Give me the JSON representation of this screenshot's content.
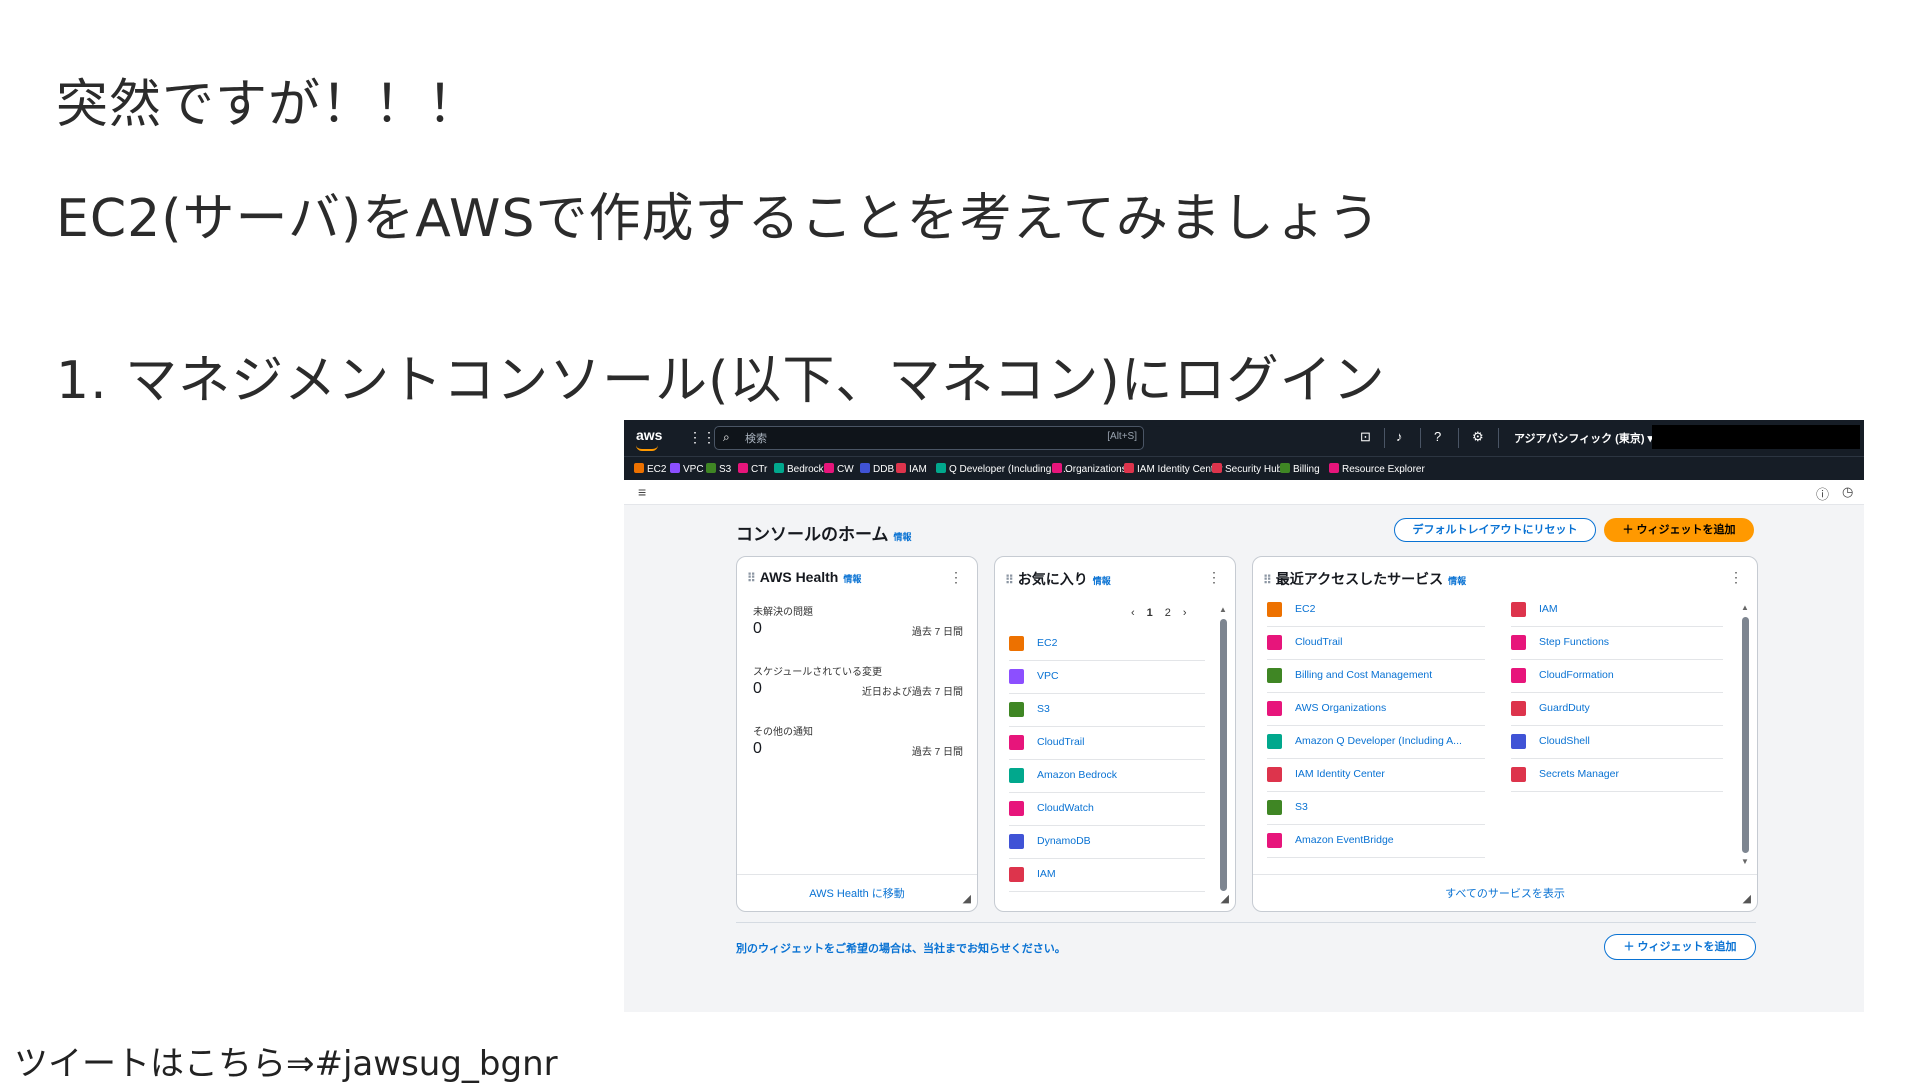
{
  "slide": {
    "line1": "突然ですが！！！",
    "line2": "EC2(サーバ)をAWSで作成することを考えてみましょう",
    "line3": "1.  マネジメントコンソール(以下、マネコン)にログイン",
    "footer": "ツイートはこちら⇒#jawsug_bgnr"
  },
  "topbar": {
    "logo": "aws",
    "search_placeholder": "検索",
    "search_shortcut": "[Alt+S]",
    "region": "アジアパシフィック (東京) ▾"
  },
  "favorites": [
    {
      "label": "EC2",
      "color": "#ed7100"
    },
    {
      "label": "VPC",
      "color": "#8c4fff"
    },
    {
      "label": "S3",
      "color": "#3f8624"
    },
    {
      "label": "CTr",
      "color": "#e7157b"
    },
    {
      "label": "Bedrock",
      "color": "#01a88d"
    },
    {
      "label": "CW",
      "color": "#e7157b"
    },
    {
      "label": "DDB",
      "color": "#4053d6"
    },
    {
      "label": "IAM",
      "color": "#dd344c"
    },
    {
      "label": "Q Developer (Including A...",
      "color": "#01a88d"
    },
    {
      "label": "Organizations",
      "color": "#e7157b"
    },
    {
      "label": "IAM Identity Center",
      "color": "#dd344c"
    },
    {
      "label": "Security Hub",
      "color": "#dd344c"
    },
    {
      "label": "Billing",
      "color": "#3f8624"
    },
    {
      "label": "Resource Explorer",
      "color": "#e7157b"
    }
  ],
  "page": {
    "title": "コンソールのホーム",
    "info": "情報",
    "reset_button": "デフォルトレイアウトにリセット",
    "add_widget_button": "＋ ウィジェットを追加",
    "bottom_note": "別のウィジェットをご希望の場合は、当社までお知らせください。",
    "add_widget_button_2": "＋ ウィジェットを追加"
  },
  "health": {
    "title": "AWS Health",
    "info": "情報",
    "items": [
      {
        "label": "未解決の問題",
        "value": "0",
        "range": "過去 7 日間"
      },
      {
        "label": "スケジュールされている変更",
        "value": "0",
        "range": "近日および過去 7 日間"
      },
      {
        "label": "その他の通知",
        "value": "0",
        "range": "過去 7 日間"
      }
    ],
    "footer_link": "AWS Health に移動"
  },
  "favorites_widget": {
    "title": "お気に入り",
    "info": "情報",
    "pager": {
      "prev": "‹",
      "page1": "1",
      "page2": "2",
      "next": "›"
    },
    "items": [
      {
        "label": "EC2",
        "color": "#ed7100"
      },
      {
        "label": "VPC",
        "color": "#8c4fff"
      },
      {
        "label": "S3",
        "color": "#3f8624"
      },
      {
        "label": "CloudTrail",
        "color": "#e7157b"
      },
      {
        "label": "Amazon Bedrock",
        "color": "#01a88d"
      },
      {
        "label": "CloudWatch",
        "color": "#e7157b"
      },
      {
        "label": "DynamoDB",
        "color": "#4053d6"
      },
      {
        "label": "IAM",
        "color": "#dd344c"
      }
    ]
  },
  "recent": {
    "title": "最近アクセスしたサービス",
    "info": "情報",
    "col1": [
      {
        "label": "EC2",
        "color": "#ed7100"
      },
      {
        "label": "CloudTrail",
        "color": "#e7157b"
      },
      {
        "label": "Billing and Cost Management",
        "color": "#3f8624"
      },
      {
        "label": "AWS Organizations",
        "color": "#e7157b"
      },
      {
        "label": "Amazon Q Developer (Including A...",
        "color": "#01a88d"
      },
      {
        "label": "IAM Identity Center",
        "color": "#dd344c"
      },
      {
        "label": "S3",
        "color": "#3f8624"
      },
      {
        "label": "Amazon EventBridge",
        "color": "#e7157b"
      }
    ],
    "col2": [
      {
        "label": "IAM",
        "color": "#dd344c"
      },
      {
        "label": "Step Functions",
        "color": "#e7157b"
      },
      {
        "label": "CloudFormation",
        "color": "#e7157b"
      },
      {
        "label": "GuardDuty",
        "color": "#dd344c"
      },
      {
        "label": "CloudShell",
        "color": "#4053d6"
      },
      {
        "label": "Secrets Manager",
        "color": "#dd344c"
      }
    ],
    "footer_link": "すべてのサービスを表示"
  }
}
